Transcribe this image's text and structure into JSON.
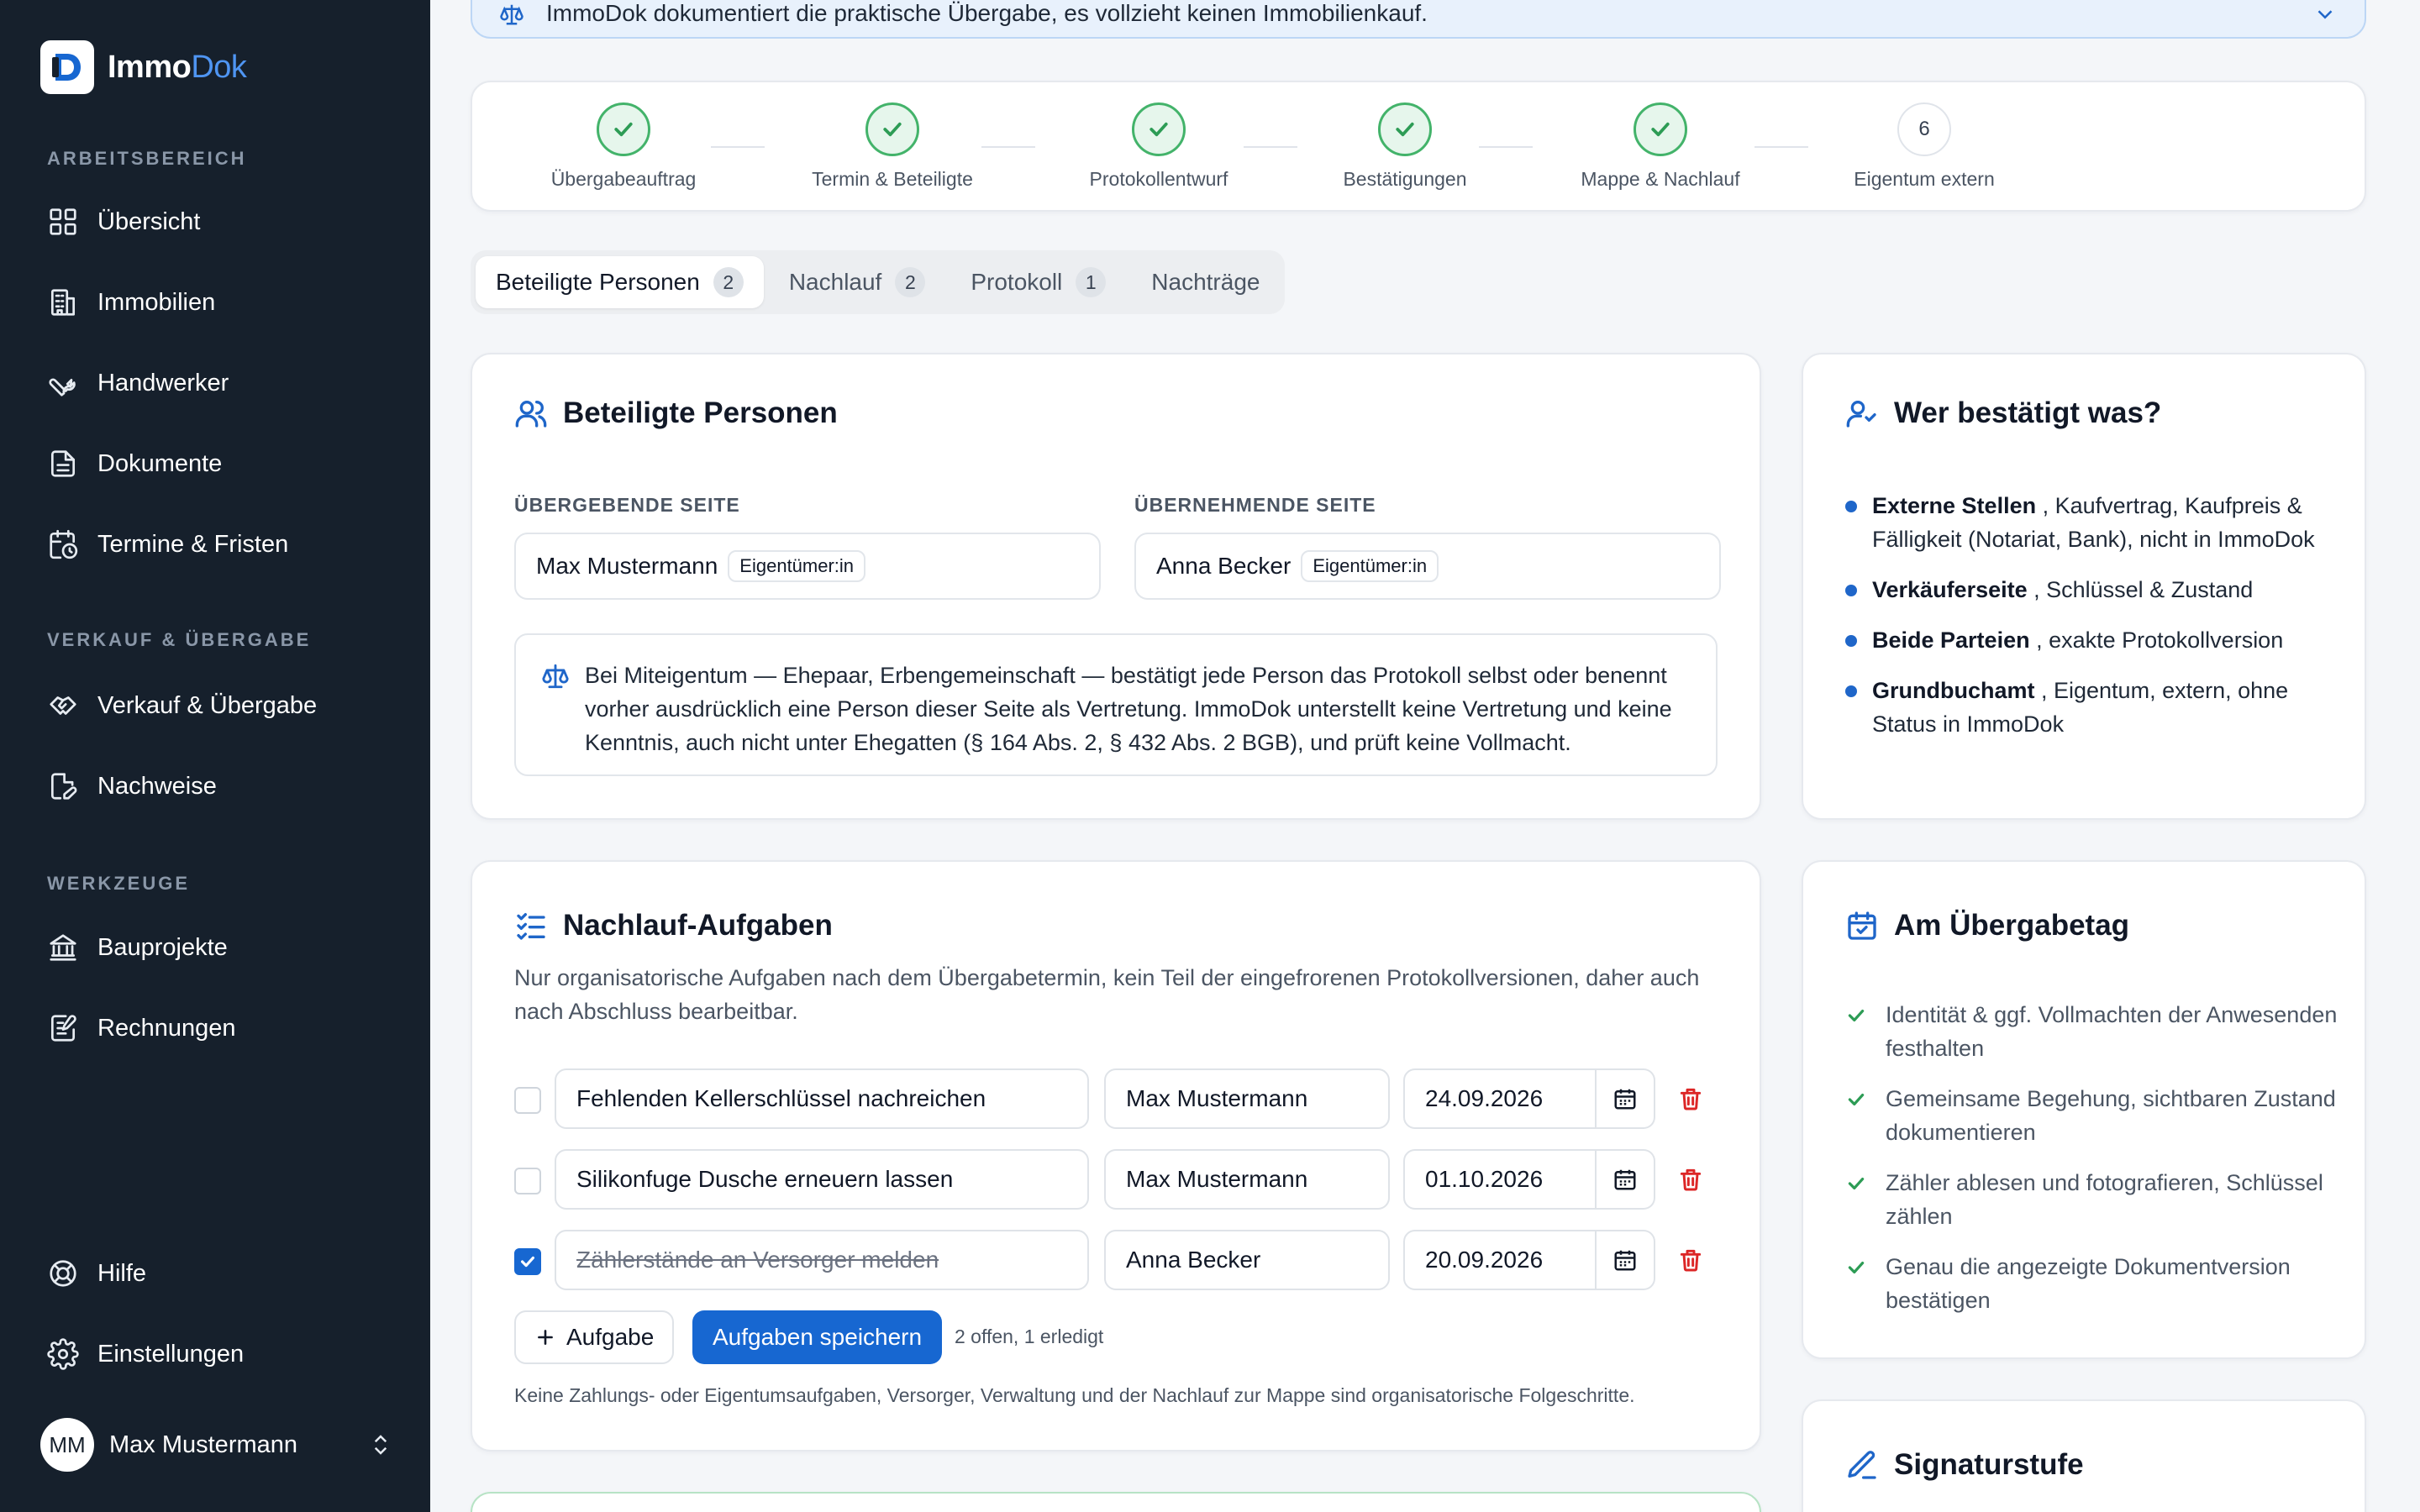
{
  "brand": {
    "name_main": "Immo",
    "name_accent": "Dok"
  },
  "sidebar": {
    "sections": [
      {
        "label": "ARBEITSBEREICH"
      },
      {
        "label": "VERKAUF & ÜBERGABE"
      },
      {
        "label": "WERKZEUGE"
      }
    ],
    "items": [
      {
        "label": "Übersicht",
        "icon": "grid-icon"
      },
      {
        "label": "Immobilien",
        "icon": "building-icon"
      },
      {
        "label": "Handwerker",
        "icon": "wrench-icon"
      },
      {
        "label": "Dokumente",
        "icon": "document-icon"
      },
      {
        "label": "Termine & Fristen",
        "icon": "calendar-clock-icon"
      },
      {
        "label": "Verkauf & Übergabe",
        "icon": "handshake-icon"
      },
      {
        "label": "Nachweise",
        "icon": "file-edit-icon"
      },
      {
        "label": "Bauprojekte",
        "icon": "bank-icon"
      },
      {
        "label": "Rechnungen",
        "icon": "receipt-icon"
      }
    ],
    "bottom": [
      {
        "label": "Hilfe",
        "icon": "lifebuoy-icon"
      },
      {
        "label": "Einstellungen",
        "icon": "gear-icon"
      }
    ],
    "user": {
      "initials": "MM",
      "name": "Max Mustermann"
    }
  },
  "banner": {
    "text": "ImmoDok dokumentiert die praktische Übergabe, es vollzieht keinen Immobilienkauf."
  },
  "stepper": [
    {
      "label": "Übergabeauftrag",
      "done": true
    },
    {
      "label": "Termin & Beteiligte",
      "done": true
    },
    {
      "label": "Protokollentwurf",
      "done": true
    },
    {
      "label": "Bestätigungen",
      "done": true
    },
    {
      "label": "Mappe & Nachlauf",
      "done": true
    },
    {
      "label": "Eigentum extern",
      "done": false,
      "number": "6"
    }
  ],
  "tabs": [
    {
      "label": "Beteiligte Personen",
      "count": "2"
    },
    {
      "label": "Nachlauf",
      "count": "2"
    },
    {
      "label": "Protokoll",
      "count": "1"
    },
    {
      "label": "Nachträge"
    }
  ],
  "persons_card": {
    "title": "Beteiligte Personen",
    "giving_label": "ÜBERGEBENDE SEITE",
    "receiving_label": "ÜBERNEHMENDE SEITE",
    "giving": {
      "name": "Max Mustermann",
      "role": "Eigentümer:in"
    },
    "receiving": {
      "name": "Anna Becker",
      "role": "Eigentümer:in"
    },
    "note": "Bei Miteigentum — Ehepaar, Erbengemeinschaft — bestätigt jede Person das Protokoll selbst oder benennt vorher ausdrücklich eine Person dieser Seite als Vertretung. ImmoDok unterstellt keine Vertretung und keine Kenntnis, auch nicht unter Ehegatten (§ 164 Abs. 2, § 432 Abs. 2 BGB), und prüft keine Vollmacht."
  },
  "who_card": {
    "title": "Wer bestätigt was?",
    "items": [
      {
        "bold": "Externe Stellen",
        "text": " , Kaufvertrag, Kaufpreis & Fälligkeit (Notariat, Bank), nicht in ImmoDok"
      },
      {
        "bold": "Verkäuferseite",
        "text": " , Schlüssel & Zustand"
      },
      {
        "bold": "Beide Parteien",
        "text": " , exakte Protokollversion"
      },
      {
        "bold": "Grundbuchamt",
        "text": " , Eigentum, extern, ohne Status in ImmoDok"
      }
    ]
  },
  "tasks_card": {
    "title": "Nachlauf-Aufgaben",
    "description": "Nur organisatorische Aufgaben nach dem Übergabetermin, kein Teil der eingefrorenen Protokollversionen, daher auch nach Abschluss bearbeitbar.",
    "tasks": [
      {
        "title": "Fehlenden Kellerschlüssel nachreichen",
        "assignee": "Max Mustermann",
        "date": "24.09.2026",
        "done": false
      },
      {
        "title": "Silikonfuge Dusche erneuern lassen",
        "assignee": "Max Mustermann",
        "date": "01.10.2026",
        "done": false
      },
      {
        "title": "Zählerstände an Versorger melden",
        "assignee": "Anna Becker",
        "date": "20.09.2026",
        "done": true
      }
    ],
    "add_label": "Aufgabe",
    "save_label": "Aufgaben speichern",
    "status_text": "2 offen, 1 erledigt",
    "footnote": "Keine Zahlungs- oder Eigentumsaufgaben, Versorger, Verwaltung und der Nachlauf zur Mappe sind organisatorische Folgeschritte."
  },
  "day_card": {
    "title": "Am Übergabetag",
    "items": [
      "Identität & ggf. Vollmachten der Anwesenden festhalten",
      "Gemeinsame Begehung, sichtbaren Zustand dokumentieren",
      "Zähler ablesen und fotografieren, Schlüssel zählen",
      "Genau die angezeigte Dokumentversion bestätigen"
    ]
  },
  "signature_card": {
    "title": "Signaturstufe"
  }
}
